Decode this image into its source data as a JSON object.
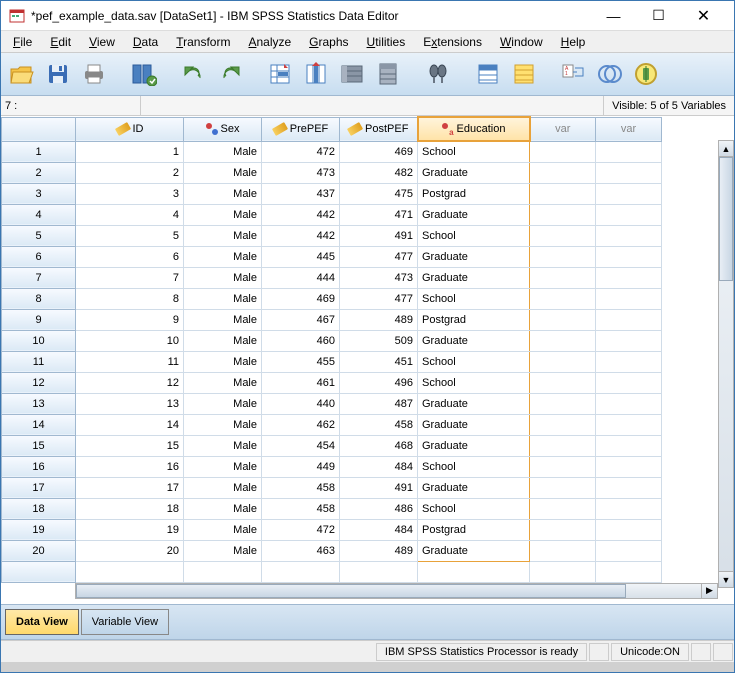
{
  "title": "*pef_example_data.sav [DataSet1] - IBM SPSS Statistics Data Editor",
  "menus": [
    "File",
    "Edit",
    "View",
    "Data",
    "Transform",
    "Analyze",
    "Graphs",
    "Utilities",
    "Extensions",
    "Window",
    "Help"
  ],
  "info_left": "7 :",
  "info_right": "Visible: 5 of 5 Variables",
  "columns": [
    {
      "name": "ID",
      "icon": "scale",
      "selected": false
    },
    {
      "name": "Sex",
      "icon": "nominal",
      "selected": false
    },
    {
      "name": "PrePEF",
      "icon": "scale",
      "selected": false
    },
    {
      "name": "PostPEF",
      "icon": "scale",
      "selected": false
    },
    {
      "name": "Education",
      "icon": "nominal-a",
      "selected": true
    },
    {
      "name": "var",
      "icon": "",
      "selected": false
    },
    {
      "name": "var",
      "icon": "",
      "selected": false
    }
  ],
  "rows": [
    {
      "n": 1,
      "id": 1,
      "sex": "Male",
      "pre": 472,
      "post": 469,
      "edu": "School"
    },
    {
      "n": 2,
      "id": 2,
      "sex": "Male",
      "pre": 473,
      "post": 482,
      "edu": "Graduate"
    },
    {
      "n": 3,
      "id": 3,
      "sex": "Male",
      "pre": 437,
      "post": 475,
      "edu": "Postgrad"
    },
    {
      "n": 4,
      "id": 4,
      "sex": "Male",
      "pre": 442,
      "post": 471,
      "edu": "Graduate"
    },
    {
      "n": 5,
      "id": 5,
      "sex": "Male",
      "pre": 442,
      "post": 491,
      "edu": "School"
    },
    {
      "n": 6,
      "id": 6,
      "sex": "Male",
      "pre": 445,
      "post": 477,
      "edu": "Graduate"
    },
    {
      "n": 7,
      "id": 7,
      "sex": "Male",
      "pre": 444,
      "post": 473,
      "edu": "Graduate"
    },
    {
      "n": 8,
      "id": 8,
      "sex": "Male",
      "pre": 469,
      "post": 477,
      "edu": "School"
    },
    {
      "n": 9,
      "id": 9,
      "sex": "Male",
      "pre": 467,
      "post": 489,
      "edu": "Postgrad"
    },
    {
      "n": 10,
      "id": 10,
      "sex": "Male",
      "pre": 460,
      "post": 509,
      "edu": "Graduate"
    },
    {
      "n": 11,
      "id": 11,
      "sex": "Male",
      "pre": 455,
      "post": 451,
      "edu": "School"
    },
    {
      "n": 12,
      "id": 12,
      "sex": "Male",
      "pre": 461,
      "post": 496,
      "edu": "School"
    },
    {
      "n": 13,
      "id": 13,
      "sex": "Male",
      "pre": 440,
      "post": 487,
      "edu": "Graduate"
    },
    {
      "n": 14,
      "id": 14,
      "sex": "Male",
      "pre": 462,
      "post": 458,
      "edu": "Graduate"
    },
    {
      "n": 15,
      "id": 15,
      "sex": "Male",
      "pre": 454,
      "post": 468,
      "edu": "Graduate"
    },
    {
      "n": 16,
      "id": 16,
      "sex": "Male",
      "pre": 449,
      "post": 484,
      "edu": "School"
    },
    {
      "n": 17,
      "id": 17,
      "sex": "Male",
      "pre": 458,
      "post": 491,
      "edu": "Graduate"
    },
    {
      "n": 18,
      "id": 18,
      "sex": "Male",
      "pre": 458,
      "post": 486,
      "edu": "School"
    },
    {
      "n": 19,
      "id": 19,
      "sex": "Male",
      "pre": 472,
      "post": 484,
      "edu": "Postgrad"
    },
    {
      "n": 20,
      "id": 20,
      "sex": "Male",
      "pre": 463,
      "post": 489,
      "edu": "Graduate"
    }
  ],
  "tabs": {
    "data_view": "Data View",
    "variable_view": "Variable View"
  },
  "status": {
    "processor": "IBM SPSS Statistics Processor is ready",
    "unicode": "Unicode:ON"
  }
}
